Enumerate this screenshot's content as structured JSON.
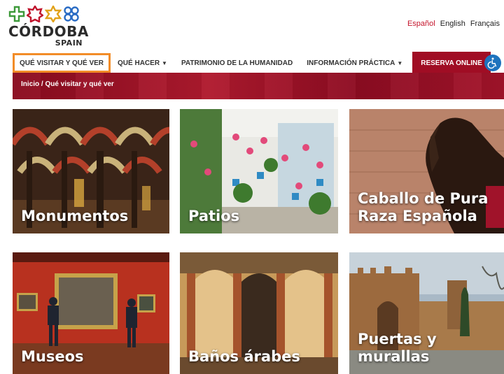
{
  "header": {
    "logo_name": "CÓRDOBA",
    "logo_sub": "SPAIN",
    "languages": [
      "Español",
      "English",
      "Français"
    ],
    "active_language": "Español"
  },
  "nav": {
    "items": [
      {
        "label": "QUÉ VISITAR Y QUÉ VER"
      },
      {
        "label": "QUÉ HACER"
      },
      {
        "label": "PATRIMONIO DE LA HUMANIDAD"
      },
      {
        "label": "INFORMACIÓN PRÁCTICA"
      }
    ],
    "reserva_label": "RESERVA ONLINE"
  },
  "breadcrumb": "Inicio / Qué visitar y qué ver",
  "tiles": [
    {
      "label": "Monumentos"
    },
    {
      "label": "Patios"
    },
    {
      "label": "Caballo de Pura Raza Española"
    },
    {
      "label": "Museos"
    },
    {
      "label": "Baños árabes"
    },
    {
      "label": "Puertas y murallas"
    }
  ],
  "colors": {
    "brand_red": "#a00d24",
    "highlight_orange": "#f28c28",
    "active_lang": "#c4152c",
    "accessibility_blue": "#1e73be"
  },
  "icons": {
    "logo": [
      "cross-icon",
      "eight-point-star-icon",
      "six-point-star-icon",
      "knot-icon"
    ],
    "accessibility": "wheelchair-icon"
  }
}
